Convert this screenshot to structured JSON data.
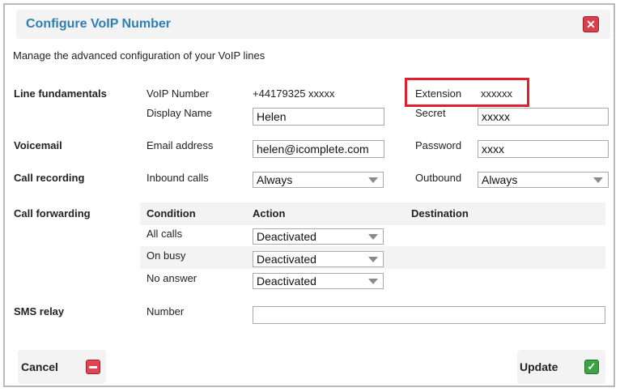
{
  "dialog": {
    "title": "Configure VoIP Number",
    "close_glyph": "✕",
    "intro": "Manage the advanced configuration of your VoIP lines"
  },
  "line": {
    "section": "Line fundamentals",
    "voip_label": "VoIP Number",
    "voip_value": "+44179325 xxxxx",
    "extension_label": "Extension",
    "extension_value": "xxxxxx",
    "display_label": "Display Name",
    "display_value": "Helen",
    "secret_label": "Secret",
    "secret_value": "xxxxx"
  },
  "voicemail": {
    "section": "Voicemail",
    "email_label": "Email address",
    "email_value": "helen@icomplete.com",
    "password_label": "Password",
    "password_value": "xxxx"
  },
  "recording": {
    "section": "Call recording",
    "inbound_label": "Inbound calls",
    "inbound_value": "Always",
    "outbound_label": "Outbound",
    "outbound_value": "Always"
  },
  "forwarding": {
    "section": "Call forwarding",
    "headers": [
      "Condition",
      "Action",
      "Destination"
    ],
    "rows": [
      {
        "condition": "All calls",
        "action": "Deactivated"
      },
      {
        "condition": "On busy",
        "action": "Deactivated"
      },
      {
        "condition": "No answer",
        "action": "Deactivated"
      }
    ]
  },
  "sms": {
    "section": "SMS relay",
    "number_label": "Number",
    "number_value": ""
  },
  "buttons": {
    "cancel": "Cancel",
    "update": "Update"
  },
  "icons": {
    "close": "close-icon",
    "cancel": "minus-icon",
    "update": "checkmark-icon"
  },
  "colors": {
    "title": "#2f7fb3",
    "close": "#d93f4c",
    "highlight": "#e0202e",
    "cancel_icon": "#e04551",
    "update_icon": "#3aa447"
  }
}
